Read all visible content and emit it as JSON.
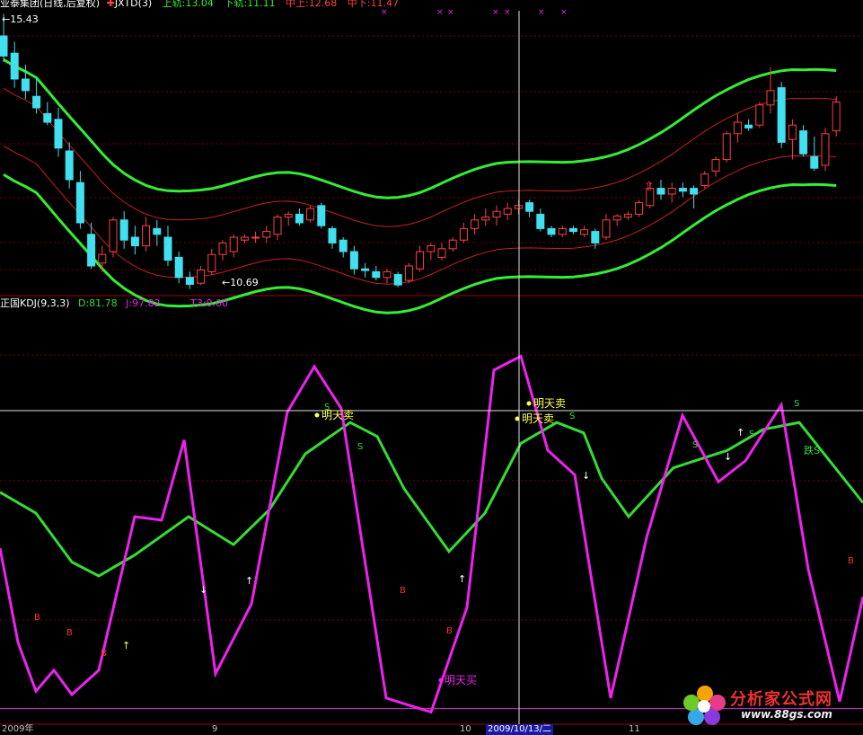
{
  "colors": {
    "up": "#ff4040",
    "down": "#40e0f0",
    "band": "#33ee33",
    "mid": "#c82020",
    "kdj_d": "#33dd33",
    "kdj_j": "#ee22ee",
    "t3": "#cc33cc",
    "grid": "#7a0000",
    "text_white": "#ffffff",
    "yellow": "#ffff55"
  },
  "header_top": {
    "title": "业泰集团(日线,后复权)",
    "indicator": "JXTD(3)",
    "upper_label": "上轨:13.04",
    "lower_label": "下轨:11.11",
    "mid_upper_label": "中上:12.68",
    "mid_lower_label": "中下:11.47"
  },
  "header_bottom": {
    "title": "正国KDJ(9,3,3)",
    "d_label": "D:81.78",
    "j_label": "J:97.82",
    "t3_label": "T3:0.00"
  },
  "high_label": "←15.43",
  "low_label": "←10.69",
  "x_axis": [
    "2009年",
    "9",
    "10",
    "2009/10/13/二",
    "11"
  ],
  "logo": {
    "line1": "分析家公式网",
    "line2": "www.88gs.com"
  },
  "chart_data": [
    {
      "type": "candlestick",
      "title": "业泰集团(日线,后复权)",
      "ylim": [
        10.55,
        15.55
      ],
      "candles": [
        [
          15.05,
          15.43,
          14.6,
          14.7
        ],
        [
          14.75,
          14.95,
          14.15,
          14.3
        ],
        [
          14.3,
          14.55,
          13.95,
          14.1
        ],
        [
          14.0,
          14.3,
          13.7,
          13.8
        ],
        [
          13.7,
          13.9,
          13.5,
          13.55
        ],
        [
          13.6,
          13.8,
          12.95,
          13.1
        ],
        [
          13.05,
          13.2,
          12.4,
          12.55
        ],
        [
          12.5,
          12.7,
          11.7,
          11.8
        ],
        [
          11.6,
          11.8,
          11.0,
          11.05
        ],
        [
          11.1,
          11.4,
          10.95,
          11.25
        ],
        [
          11.3,
          11.9,
          11.2,
          11.85
        ],
        [
          11.85,
          12.0,
          11.35,
          11.5
        ],
        [
          11.55,
          11.75,
          11.25,
          11.4
        ],
        [
          11.4,
          11.9,
          11.3,
          11.75
        ],
        [
          11.7,
          11.85,
          11.4,
          11.6
        ],
        [
          11.55,
          11.75,
          11.05,
          11.15
        ],
        [
          11.2,
          11.3,
          10.75,
          10.85
        ],
        [
          10.85,
          10.95,
          10.65,
          10.73
        ],
        [
          10.75,
          11.05,
          10.72,
          10.98
        ],
        [
          10.95,
          11.35,
          10.9,
          11.25
        ],
        [
          11.25,
          11.5,
          11.15,
          11.45
        ],
        [
          11.3,
          11.6,
          11.2,
          11.55
        ],
        [
          11.5,
          11.6,
          11.45,
          11.55
        ],
        [
          11.55,
          11.65,
          11.45,
          11.55
        ],
        [
          11.55,
          11.75,
          11.45,
          11.65
        ],
        [
          11.6,
          11.95,
          11.5,
          11.9
        ],
        [
          11.9,
          12.0,
          11.75,
          11.95
        ],
        [
          11.95,
          12.05,
          11.75,
          11.8
        ],
        [
          11.85,
          12.1,
          11.8,
          12.05
        ],
        [
          12.1,
          12.15,
          11.7,
          11.75
        ],
        [
          11.7,
          11.75,
          11.35,
          11.45
        ],
        [
          11.5,
          11.55,
          11.2,
          11.3
        ],
        [
          11.3,
          11.4,
          10.9,
          11.0
        ],
        [
          11.0,
          11.1,
          10.85,
          10.97
        ],
        [
          10.95,
          11.05,
          10.8,
          10.85
        ],
        [
          10.85,
          11.0,
          10.75,
          10.95
        ],
        [
          10.9,
          10.95,
          10.68,
          10.72
        ],
        [
          10.8,
          11.1,
          10.75,
          11.05
        ],
        [
          11.0,
          11.4,
          10.95,
          11.3
        ],
        [
          11.3,
          11.45,
          11.15,
          11.4
        ],
        [
          11.2,
          11.45,
          11.15,
          11.35
        ],
        [
          11.35,
          11.55,
          11.3,
          11.5
        ],
        [
          11.5,
          11.8,
          11.45,
          11.7
        ],
        [
          11.7,
          11.95,
          11.6,
          11.85
        ],
        [
          11.85,
          12.05,
          11.75,
          11.9
        ],
        [
          11.9,
          12.1,
          11.75,
          12.0
        ],
        [
          11.95,
          12.15,
          11.85,
          12.05
        ],
        [
          12.05,
          12.2,
          11.95,
          12.1
        ],
        [
          12.15,
          12.2,
          11.9,
          12.0
        ],
        [
          11.95,
          12.05,
          11.65,
          11.7
        ],
        [
          11.7,
          11.75,
          11.55,
          11.6
        ],
        [
          11.6,
          11.75,
          11.55,
          11.7
        ],
        [
          11.7,
          11.75,
          11.6,
          11.65
        ],
        [
          11.6,
          11.75,
          11.55,
          11.68
        ],
        [
          11.65,
          11.7,
          11.35,
          11.45
        ],
        [
          11.55,
          11.95,
          11.5,
          11.85
        ],
        [
          11.85,
          11.95,
          11.75,
          11.92
        ],
        [
          11.9,
          12.0,
          11.85,
          11.95
        ],
        [
          11.95,
          12.2,
          11.9,
          12.15
        ],
        [
          12.1,
          12.5,
          12.05,
          12.4
        ],
        [
          12.4,
          12.55,
          12.2,
          12.3
        ],
        [
          12.3,
          12.5,
          12.15,
          12.4
        ],
        [
          12.4,
          12.5,
          12.25,
          12.35
        ],
        [
          12.4,
          12.45,
          12.05,
          12.3
        ],
        [
          12.45,
          12.7,
          12.4,
          12.65
        ],
        [
          12.7,
          12.95,
          12.6,
          12.9
        ],
        [
          12.9,
          13.4,
          12.85,
          13.35
        ],
        [
          13.35,
          13.7,
          13.2,
          13.55
        ],
        [
          13.5,
          13.6,
          13.4,
          13.45
        ],
        [
          13.5,
          13.9,
          13.45,
          13.85
        ],
        [
          13.85,
          14.5,
          13.7,
          14.1
        ],
        [
          14.15,
          14.25,
          13.1,
          13.2
        ],
        [
          13.25,
          13.6,
          12.9,
          13.5
        ],
        [
          13.4,
          13.5,
          12.95,
          13.0
        ],
        [
          12.95,
          13.3,
          12.7,
          12.75
        ],
        [
          12.8,
          13.45,
          12.7,
          13.35
        ],
        [
          13.4,
          14.0,
          13.3,
          13.9
        ]
      ]
    },
    {
      "type": "line",
      "title": "正国KDJ(9,3,3)",
      "ylim": [
        -5,
        115
      ],
      "x": [
        "2009年",
        "9",
        "10",
        "2009/10/13/二",
        "11"
      ],
      "series": [
        {
          "name": "D",
          "values": [
            [
              0,
              62
            ],
            [
              40,
              56
            ],
            [
              80,
              42
            ],
            [
              110,
              38
            ],
            [
              150,
              44
            ],
            [
              210,
              55
            ],
            [
              260,
              47
            ],
            [
              300,
              57
            ],
            [
              340,
              73
            ],
            [
              390,
              82
            ],
            [
              420,
              78
            ],
            [
              450,
              63
            ],
            [
              500,
              45
            ],
            [
              540,
              56
            ],
            [
              580,
              76
            ],
            [
              620,
              82
            ],
            [
              650,
              79
            ],
            [
              670,
              66
            ],
            [
              700,
              55
            ],
            [
              750,
              69
            ],
            [
              810,
              74
            ],
            [
              850,
              80
            ],
            [
              890,
              82
            ],
            [
              930,
              69
            ],
            [
              961,
              59
            ]
          ]
        },
        {
          "name": "J",
          "values": [
            [
              0,
              46
            ],
            [
              20,
              19
            ],
            [
              40,
              5
            ],
            [
              60,
              11
            ],
            [
              80,
              4
            ],
            [
              110,
              11
            ],
            [
              150,
              55
            ],
            [
              180,
              54
            ],
            [
              205,
              77
            ],
            [
              240,
              10
            ],
            [
              280,
              30
            ],
            [
              320,
              85
            ],
            [
              350,
              98
            ],
            [
              380,
              86
            ],
            [
              430,
              3
            ],
            [
              480,
              -1
            ],
            [
              520,
              29
            ],
            [
              550,
              97
            ],
            [
              580,
              101
            ],
            [
              610,
              74
            ],
            [
              640,
              67
            ],
            [
              680,
              3
            ],
            [
              720,
              49
            ],
            [
              760,
              84
            ],
            [
              800,
              65
            ],
            [
              830,
              71
            ],
            [
              870,
              87
            ],
            [
              900,
              40
            ],
            [
              935,
              2
            ],
            [
              961,
              32
            ]
          ]
        },
        {
          "name": "T3",
          "values": [
            [
              0,
              0
            ],
            [
              961,
              0
            ]
          ]
        }
      ]
    }
  ],
  "signals": {
    "buy": "B",
    "sell": "S",
    "tomorrow_sell": "明天卖",
    "tomorrow_buy": "明天买",
    "up_arrow": "↑",
    "down_arrow": "↓",
    "break_sell": "跌S"
  }
}
